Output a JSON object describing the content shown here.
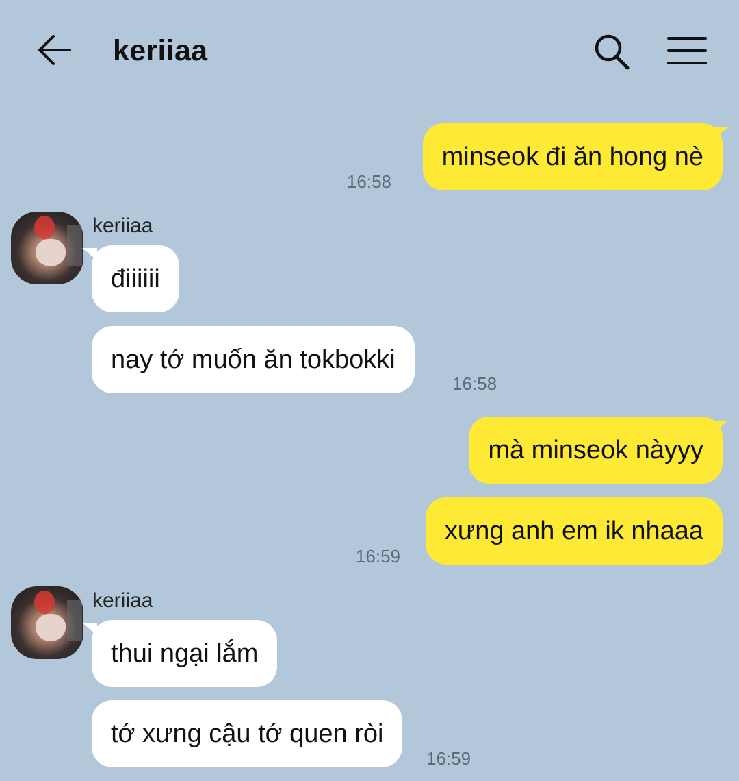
{
  "header": {
    "back_icon": "arrow-left-icon",
    "title": "keriiaa",
    "search_icon": "search-icon",
    "menu_icon": "hamburger-menu-icon"
  },
  "colors": {
    "background": "#b2c7da",
    "outgoing_bubble": "#fee934",
    "incoming_bubble": "#ffffff",
    "timestamp": "#5f6a78"
  },
  "messages": [
    {
      "direction": "outgoing",
      "text": "minseok đi ăn hong nè",
      "time": "16:58"
    },
    {
      "direction": "incoming",
      "sender": "keriiaa",
      "text": "điiiiii"
    },
    {
      "direction": "incoming",
      "text": "nay tớ muốn ăn tokbokki",
      "time": "16:58"
    },
    {
      "direction": "outgoing",
      "text": "mà minseok nàyyy"
    },
    {
      "direction": "outgoing",
      "text": "xưng anh em ik nhaaa",
      "time": "16:59"
    },
    {
      "direction": "incoming",
      "sender": "keriiaa",
      "text": "thui ngại lắm"
    },
    {
      "direction": "incoming",
      "text": "tớ xưng cậu tớ quen ròi",
      "time": "16:59"
    }
  ]
}
